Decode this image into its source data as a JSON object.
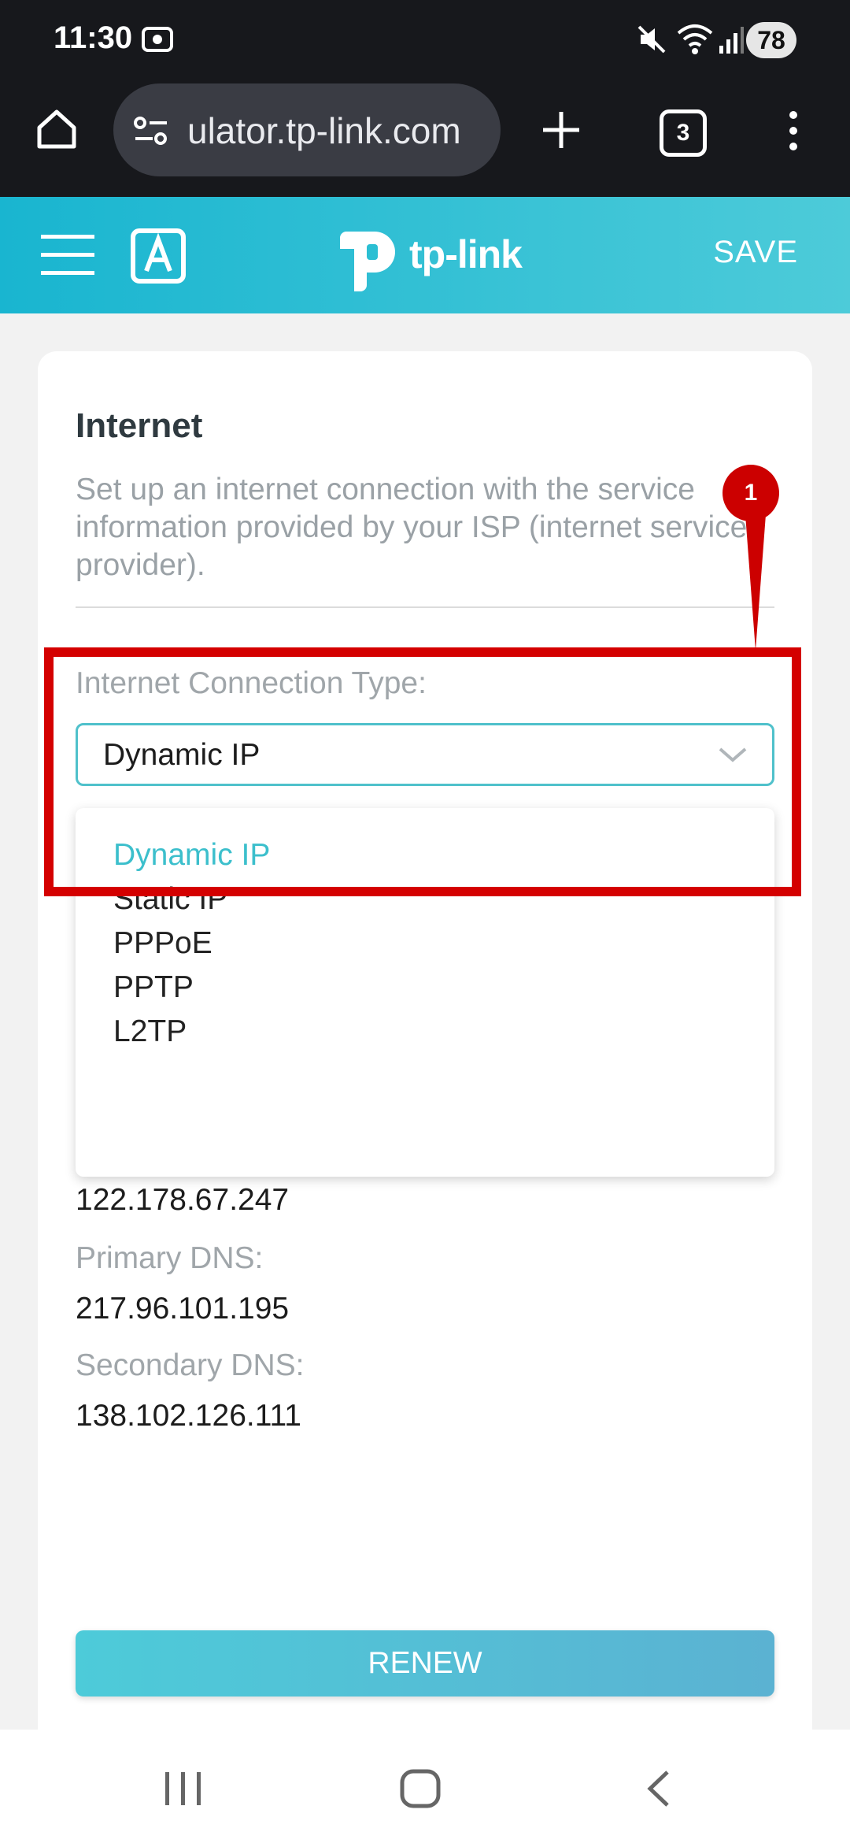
{
  "status_bar": {
    "time": "11:30",
    "battery": "78"
  },
  "browser": {
    "url": "ulator.tp-link.com",
    "tab_count": "3"
  },
  "app_header": {
    "brand": "tp-link",
    "save_label": "SAVE"
  },
  "card": {
    "title": "Internet",
    "description": "Set up an internet connection with the service information provided by your ISP (internet service provider).",
    "connection_type_label": "Internet Connection Type:",
    "connection_type_value": "Dynamic IP",
    "options": [
      "Dynamic IP",
      "Static IP",
      "PPPoE",
      "PPTP",
      "L2TP"
    ],
    "default_gateway_value": "122.178.67.247",
    "primary_dns_label": "Primary DNS:",
    "primary_dns_value": "217.96.101.195",
    "secondary_dns_label": "Secondary DNS:",
    "secondary_dns_value": "138.102.126.111",
    "renew_label": "RENEW"
  },
  "annotation": {
    "step": "1"
  },
  "colors": {
    "accent": "#3cbfcc",
    "highlight": "#d40000",
    "header_start": "#19b5d0",
    "header_end": "#4dcbd9"
  },
  "icons": [
    "silent-icon",
    "wifi-icon",
    "signal-icon",
    "home-icon",
    "site-settings-icon",
    "new-tab-icon",
    "menu-icon",
    "hamburger-icon",
    "tp-link-logo",
    "chevron-down-icon",
    "recents-icon",
    "home-nav-icon",
    "back-icon"
  ]
}
